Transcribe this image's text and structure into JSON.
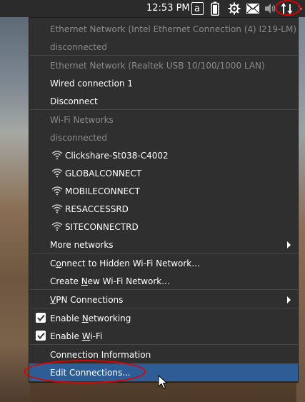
{
  "panel": {
    "clock": "12:53 PM",
    "keyboard_layout": "a",
    "icons": [
      "keyboard-layout-icon",
      "battery-icon",
      "gear-icon",
      "mail-icon",
      "volume-icon",
      "network-icon",
      "arrow-icon"
    ]
  },
  "menu": {
    "ethernet_intel_header": "Ethernet Network (Intel Ethernet Connection (4) I219-LM)",
    "ethernet_intel_status": "disconnected",
    "ethernet_realtek_header": "Ethernet Network (Realtek USB 10/100/1000 LAN)",
    "wired_connection": "Wired connection 1",
    "disconnect": "Disconnect",
    "wifi_header": "Wi-Fi Networks",
    "wifi_status": "disconnected",
    "networks": [
      {
        "ssid": "Clickshare-St038-C4002"
      },
      {
        "ssid": "GLOBALCONNECT"
      },
      {
        "ssid": "MOBILECONNECT"
      },
      {
        "ssid": "RESACCESSRD"
      },
      {
        "ssid": "SITECONNECTRD"
      }
    ],
    "more_networks": "More networks",
    "hidden_pre": "C",
    "hidden_mn": "o",
    "hidden_post": "nnect to Hidden Wi-Fi Network...",
    "create_pre": "Create ",
    "create_mn": "N",
    "create_post": "ew Wi-Fi Network...",
    "vpn_mn": "V",
    "vpn_post": "PN Connections",
    "enable_networking_pre": "Enable ",
    "enable_networking_mn": "N",
    "enable_networking_post": "etworking",
    "enable_networking_checked": true,
    "enable_wifi_pre": "Enable ",
    "enable_wifi_mn": "W",
    "enable_wifi_post": "i-Fi",
    "enable_wifi_checked": true,
    "connection_information": "Connection Information",
    "edit_connections": "Edit Connections..."
  },
  "colors": {
    "menu_bg": "#2f2f2f",
    "highlight": "#2e5d96",
    "disabled_text": "#8a8a8a",
    "annotation": "#e00000"
  }
}
